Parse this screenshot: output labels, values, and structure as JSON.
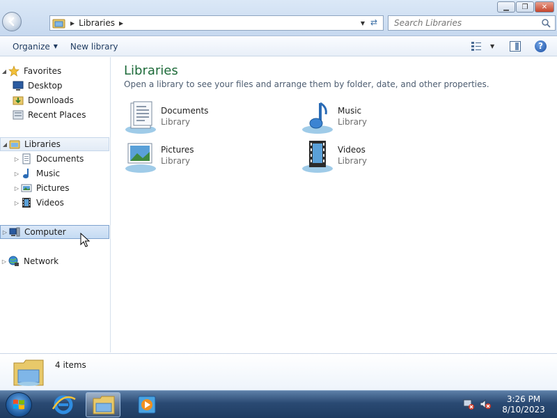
{
  "window": {
    "address": {
      "crumb": "Libraries"
    },
    "search": {
      "placeholder": "Search Libraries"
    }
  },
  "toolbar": {
    "organize_label": "Organize",
    "new_library_label": "New library"
  },
  "nav": {
    "favorites": {
      "label": "Favorites",
      "items": [
        "Desktop",
        "Downloads",
        "Recent Places"
      ]
    },
    "libraries": {
      "label": "Libraries",
      "items": [
        "Documents",
        "Music",
        "Pictures",
        "Videos"
      ]
    },
    "computer": {
      "label": "Computer"
    },
    "network": {
      "label": "Network"
    }
  },
  "content": {
    "title": "Libraries",
    "description": "Open a library to see your files and arrange them by folder, date, and other properties.",
    "libraries": [
      {
        "name": "Documents",
        "type": "Library",
        "icon": "documents-library-icon"
      },
      {
        "name": "Music",
        "type": "Library",
        "icon": "music-library-icon"
      },
      {
        "name": "Pictures",
        "type": "Library",
        "icon": "pictures-library-icon"
      },
      {
        "name": "Videos",
        "type": "Library",
        "icon": "videos-library-icon"
      }
    ]
  },
  "details": {
    "count_text": "4 items"
  },
  "taskbar": {
    "time": "3:26 PM",
    "date": "8/10/2023"
  },
  "colors": {
    "title_green": "#1e6b3a",
    "selection_blue": "#c5dbf3",
    "taskbar": "#2a4a73"
  }
}
